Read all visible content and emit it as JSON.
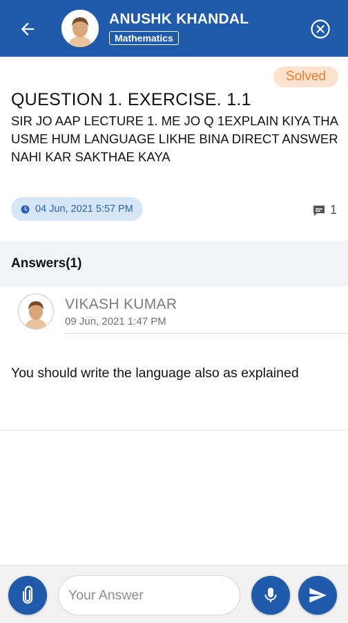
{
  "header": {
    "user_name": "ANUSHK KHANDAL",
    "subject": "Mathematics",
    "back_icon": "arrow-left-icon",
    "close_icon": "close-circle-icon",
    "background_color": "#1f5aab"
  },
  "question": {
    "status": "Solved",
    "title": "QUESTION 1. EXERCISE. 1.1",
    "body": "SIR JO AAP LECTURE 1. ME JO Q 1EXPLAIN KIYA THA USME HUM LANGUAGE LIKHE BINA DIRECT ANSWER NAHI KAR SAKTHAE KAYA",
    "date": "04 Jun, 2021 5:57 PM",
    "comment_count": "1"
  },
  "answers": {
    "title": "Answers(1)",
    "items": [
      {
        "author": "VIKASH KUMAR",
        "date": "09 Jun, 2021 1:47 PM",
        "text": "You should write the language also as explained"
      }
    ]
  },
  "compose": {
    "placeholder": "Your Answer",
    "value": "",
    "accent_color": "#1f5aab"
  }
}
